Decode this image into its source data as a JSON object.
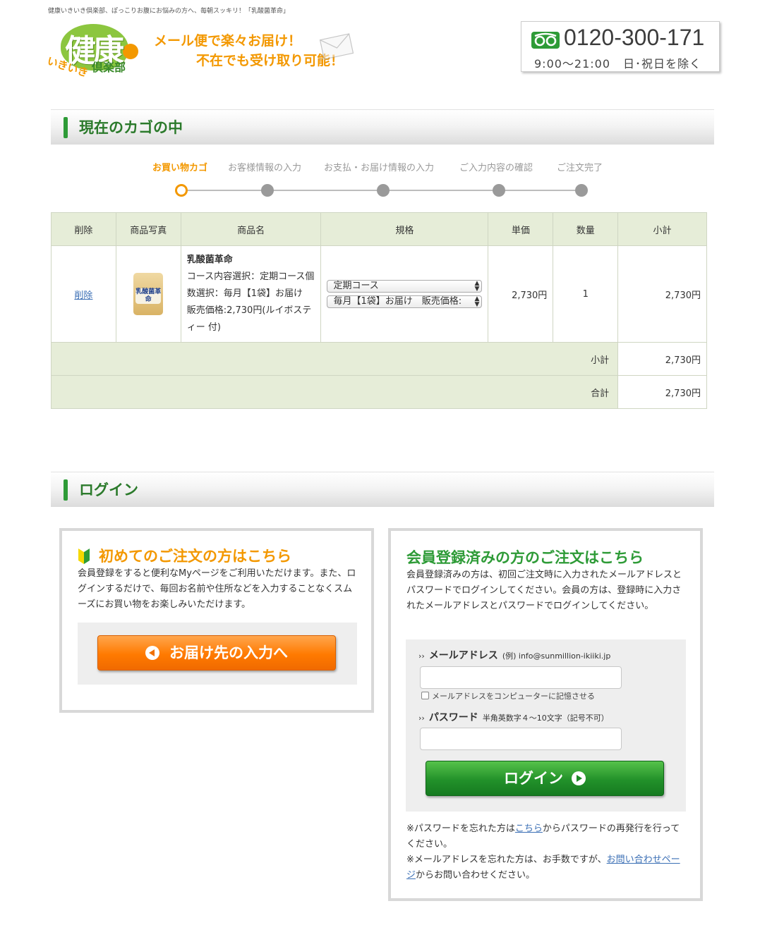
{
  "header": {
    "tagline": "健康いきいき倶楽部、ぽっこりお腹にお悩みの方へ、毎朝スッキリ！「乳酸菌革命」",
    "logo_main": "健康",
    "logo_sub1": "いきいき",
    "logo_sub2": "倶楽部",
    "promo_line1": "メール便で楽々お届け！",
    "promo_line2": "不在でも受け取り可能！",
    "phone_number": "0120-300-171",
    "hours": "9:00～21:00",
    "closed_days": "日･祝日を除く",
    "colors": {
      "accent_orange": "#f39800",
      "brand_green": "#2e9b37"
    }
  },
  "cart_section": {
    "title": "現在のカゴの中"
  },
  "steps": [
    {
      "label": "お買い物カゴ",
      "active": true
    },
    {
      "label": "お客様情報の入力",
      "active": false
    },
    {
      "label": "お支払・お届け情報の入力",
      "active": false
    },
    {
      "label": "ご入力内容の確認",
      "active": false
    },
    {
      "label": "ご注文完了",
      "active": false
    }
  ],
  "cart_table": {
    "headers": [
      "削除",
      "商品写真",
      "商品名",
      "規格",
      "単価",
      "数量",
      "小計"
    ],
    "items": [
      {
        "delete_label": "削除",
        "thumb_text": "乳酸菌革命",
        "name": "乳酸菌革命",
        "description": "コース内容選択：定期コース個数選択：毎月【1袋】お届け　販売価格:2,730円(ルイボスティー 付)",
        "spec_course": "定期コース",
        "spec_quantity": "毎月【1袋】お届け　販売価格:",
        "unit_price": "2,730円",
        "quantity": "1",
        "subtotal": "2,730円"
      }
    ],
    "subtotal_label": "小計",
    "subtotal_value": "2,730円",
    "total_label": "合計",
    "total_value": "2,730円"
  },
  "login_section": {
    "title": "ログイン"
  },
  "first_order": {
    "title": "初めてのご注文の方はこちら",
    "text": "会員登録をすると便利なMyページをご利用いただけます。また、ログインするだけで、毎回お名前や住所などを入力することなくスムーズにお買い物をお楽しみいただけます。",
    "button": "お届け先の入力へ"
  },
  "member_login": {
    "title": "会員登録済みの方のご注文はこちら",
    "text": "会員登録済みの方は、初回ご注文時に入力されたメールアドレスとパスワードでログインしてください。会員の方は、登録時に入力されたメールアドレスとパスワードでログインしてください。",
    "email_label": "メールアドレス",
    "email_example": "(例) info@sunmillion-ikiiki.jp",
    "email_value": "",
    "remember_label": "メールアドレスをコンピューターに記憶させる",
    "password_label": "パスワード",
    "password_note": "半角英数字４～10文字（記号不可）",
    "password_value": "",
    "button": "ログイン",
    "forgot_pw_before": "※パスワードを忘れた方は",
    "forgot_pw_link": "こちら",
    "forgot_pw_after": "からパスワードの再発行を行ってください。",
    "forgot_email_before": "※メールアドレスを忘れた方は、お手数ですが、",
    "forgot_email_link": "お問い合わせページ",
    "forgot_email_after": "からお問い合わせください。"
  }
}
